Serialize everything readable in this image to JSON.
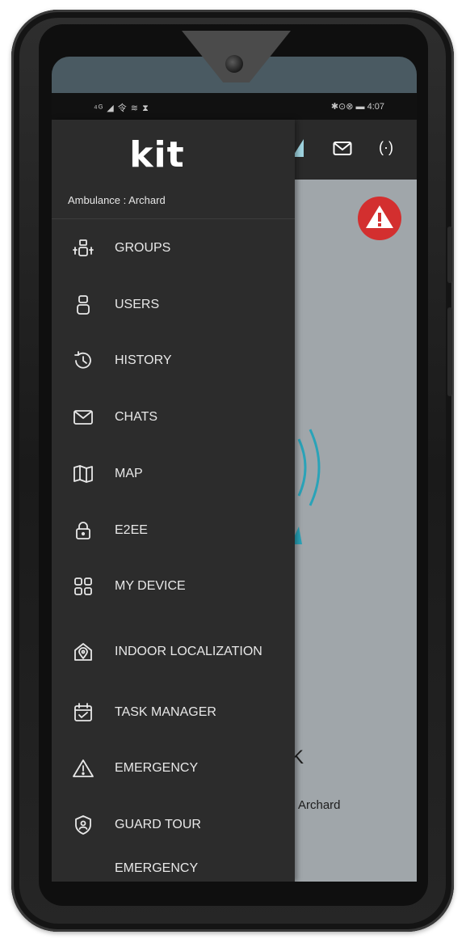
{
  "status_bar": {
    "left": "⁴ᴳ ◢ 令 ≋ ⧗",
    "right": "✱⊙⊗ ▬ 4:07"
  },
  "app_bar": {
    "mail_icon": "mail-icon",
    "broadcast_label": "(·)"
  },
  "content": {
    "partial_letter": "K",
    "partial_name": "Archard"
  },
  "drawer": {
    "brand": "kit",
    "subtitle": "Ambulance : Archard",
    "items": [
      {
        "label": "GROUPS",
        "icon": "groups-icon"
      },
      {
        "label": "USERS",
        "icon": "user-icon"
      },
      {
        "label": "HISTORY",
        "icon": "history-icon"
      },
      {
        "label": "CHATS",
        "icon": "mail-icon"
      },
      {
        "label": "MAP",
        "icon": "map-icon"
      },
      {
        "label": "E2EE",
        "icon": "lock-icon"
      },
      {
        "label": "MY DEVICE",
        "icon": "grid-icon"
      },
      {
        "label": "INDOOR LOCALIZATION",
        "icon": "indoor-location-icon"
      },
      {
        "label": "TASK MANAGER",
        "icon": "calendar-check-icon"
      },
      {
        "label": "EMERGENCY",
        "icon": "warning-icon"
      },
      {
        "label": "GUARD TOUR",
        "icon": "shield-user-icon"
      },
      {
        "label": "EMERGENCY",
        "icon": "emergency-icon"
      }
    ]
  },
  "colors": {
    "alert": "#d32f2f",
    "accent": "#2aa3b8",
    "drawer_bg": "#2c2c2c"
  }
}
